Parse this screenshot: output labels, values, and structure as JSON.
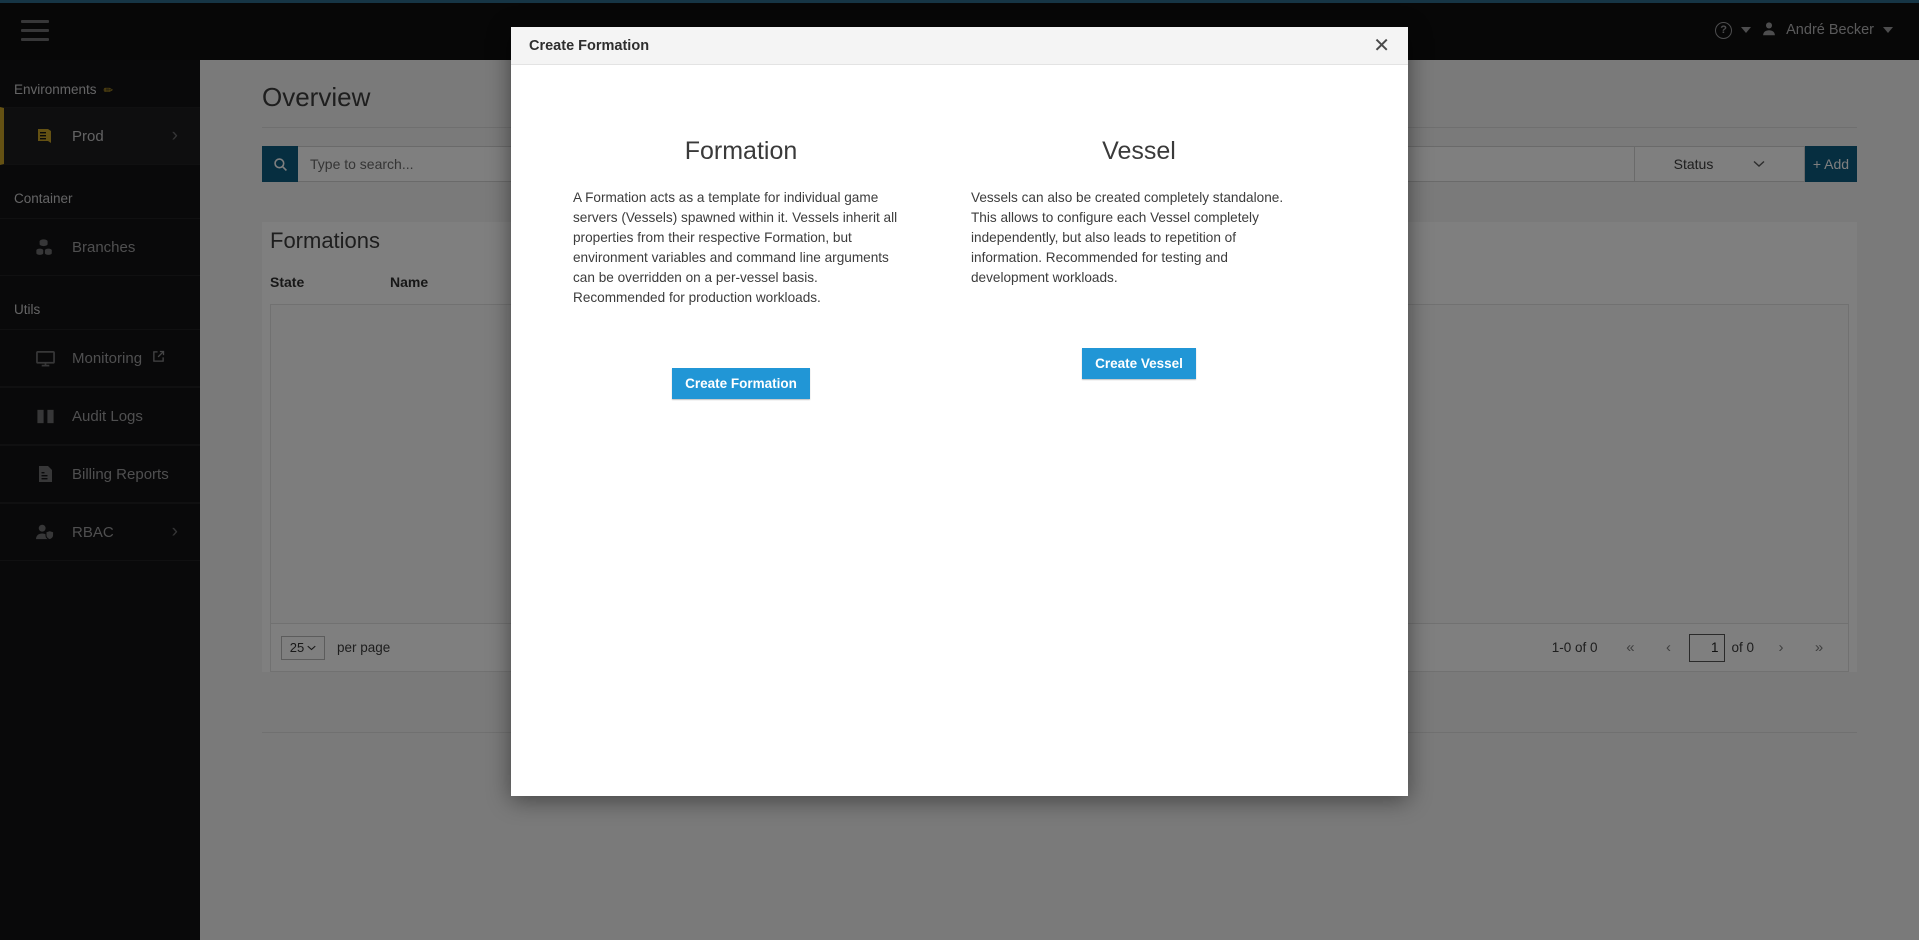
{
  "topbar": {
    "menu_icon": "hamburger-menu-icon",
    "help_icon": "question-mark-circle-icon",
    "help_caret": "chevron-down-icon",
    "avatar_icon": "user-avatar-icon",
    "user_name": "André Becker",
    "user_caret": "chevron-down-icon"
  },
  "sidebar": {
    "environments_label": "Environments",
    "environments_edit_icon": "pencil-icon",
    "environments": [
      {
        "label": "Prod",
        "icon": "server-stack-icon",
        "chevron": "chevron-right-icon",
        "active": true
      }
    ],
    "container_label": "Container",
    "container_items": [
      {
        "label": "Branches",
        "icon": "database-branches-icon"
      }
    ],
    "utils_label": "Utils",
    "utils_items": [
      {
        "label": "Monitoring",
        "icon": "monitor-screen-icon",
        "external": "external-link-icon"
      },
      {
        "label": "Audit Logs",
        "icon": "open-book-icon"
      },
      {
        "label": "Billing Reports",
        "icon": "document-report-icon"
      },
      {
        "label": "RBAC",
        "icon": "user-shield-icon",
        "chevron": "chevron-right-icon"
      }
    ]
  },
  "main": {
    "page_title": "Overview",
    "search": {
      "icon": "search-icon",
      "placeholder": "Type to search...",
      "value": ""
    },
    "status_filter": {
      "label": "Status",
      "caret": "chevron-down-icon"
    },
    "add_button": {
      "label": "+ Add"
    },
    "panel_title": "Formations",
    "table": {
      "columns": [
        "State",
        "Name"
      ],
      "rows": []
    },
    "pagination": {
      "per_page_value": "25",
      "per_page_caret": "chevron-down-icon",
      "per_page_label": "per page",
      "range_label": "1-0 of 0",
      "first_icon": "«",
      "prev_icon": "‹",
      "page_value": "1",
      "of_label": "of 0",
      "next_icon": "›",
      "last_icon": "»"
    }
  },
  "modal": {
    "title": "Create Formation",
    "close_icon": "close-x-icon",
    "columns": [
      {
        "title": "Formation",
        "description": "A Formation acts as a template for individual game servers (Vessels) spawned within it. Vessels inherit all properties from their respective Formation, but environment variables and command line arguments can be overridden on a per-vessel basis. Recommended for production workloads.",
        "button_label": "Create Formation"
      },
      {
        "title": "Vessel",
        "description": "Vessels can also be created completely standalone. This allows to configure each Vessel completely independently, but also leads to repetition of information. Recommended for testing and development workloads.",
        "button_label": "Create Vessel"
      }
    ]
  },
  "colors": {
    "accent_blue": "#0d5c80",
    "button_blue": "#2196d6",
    "sidebar_active": "#c9a227",
    "topbar_bg": "#0e0e0f",
    "sidebar_bg": "#131314"
  }
}
